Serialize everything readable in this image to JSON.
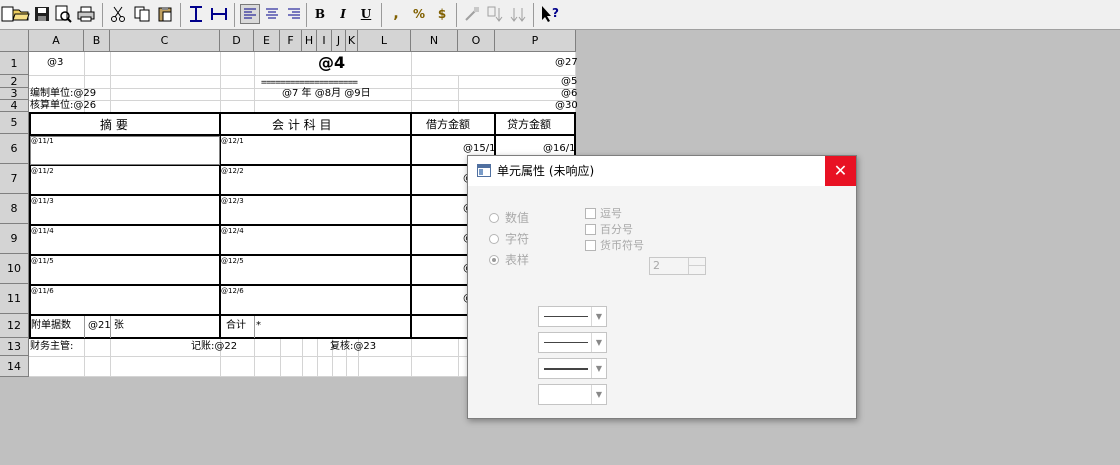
{
  "toolbar": {
    "comma": ",",
    "percent": "%",
    "currency": "$",
    "bold": "B",
    "italic": "I",
    "underline": "U",
    "help": "?"
  },
  "columns": [
    "A",
    "B",
    "C",
    "D",
    "E",
    "F",
    "H",
    "I",
    "J",
    "K",
    "L",
    "N",
    "O",
    "P"
  ],
  "rows": [
    "1",
    "2",
    "3",
    "4",
    "5",
    "6",
    "7",
    "8",
    "9",
    "10",
    "11",
    "12",
    "13",
    "14"
  ],
  "sheet": {
    "r1_a": "@3",
    "r1_title": "@4",
    "r1_p": "@27",
    "r2_rule": "====================",
    "r2_p": "@5",
    "r3_left": "编制单位:@29",
    "r3_date": "@7  年 @8月 @9日",
    "r3_p": "@6",
    "r4_left": "核算单位:@26",
    "r4_p": "@30",
    "h_summary": "摘   要",
    "h_account": "会 计 科 目",
    "h_debit": "借方金额",
    "h_credit": "贷方金额",
    "summary_rows": [
      "@11/1",
      "@11/2",
      "@11/3",
      "@11/4",
      "@11/5",
      "@11/6"
    ],
    "account_rows": [
      "@12/1",
      "@12/2",
      "@12/3",
      "@12/4",
      "@12/5",
      "@12/6"
    ],
    "debit_first": "@15/1",
    "debit_partial": [
      "@",
      "@",
      "@",
      "@",
      "@"
    ],
    "credit_first": "@16/1",
    "attach_label": "附单据数",
    "attach_value": "@21 张",
    "total_label": "合计",
    "total_value": "*",
    "r13_finance": "财务主管:",
    "r13_book": "记账:@22",
    "r13_review": "复核:@23"
  },
  "dialog": {
    "title": "单元属性 (未响应)",
    "close": "✕",
    "radio_numeric": "数值",
    "radio_text": "字符",
    "radio_style": "表样",
    "check_comma": "逗号",
    "check_percent": "百分号",
    "check_currency": "货币符号",
    "decimals_value": "2"
  }
}
